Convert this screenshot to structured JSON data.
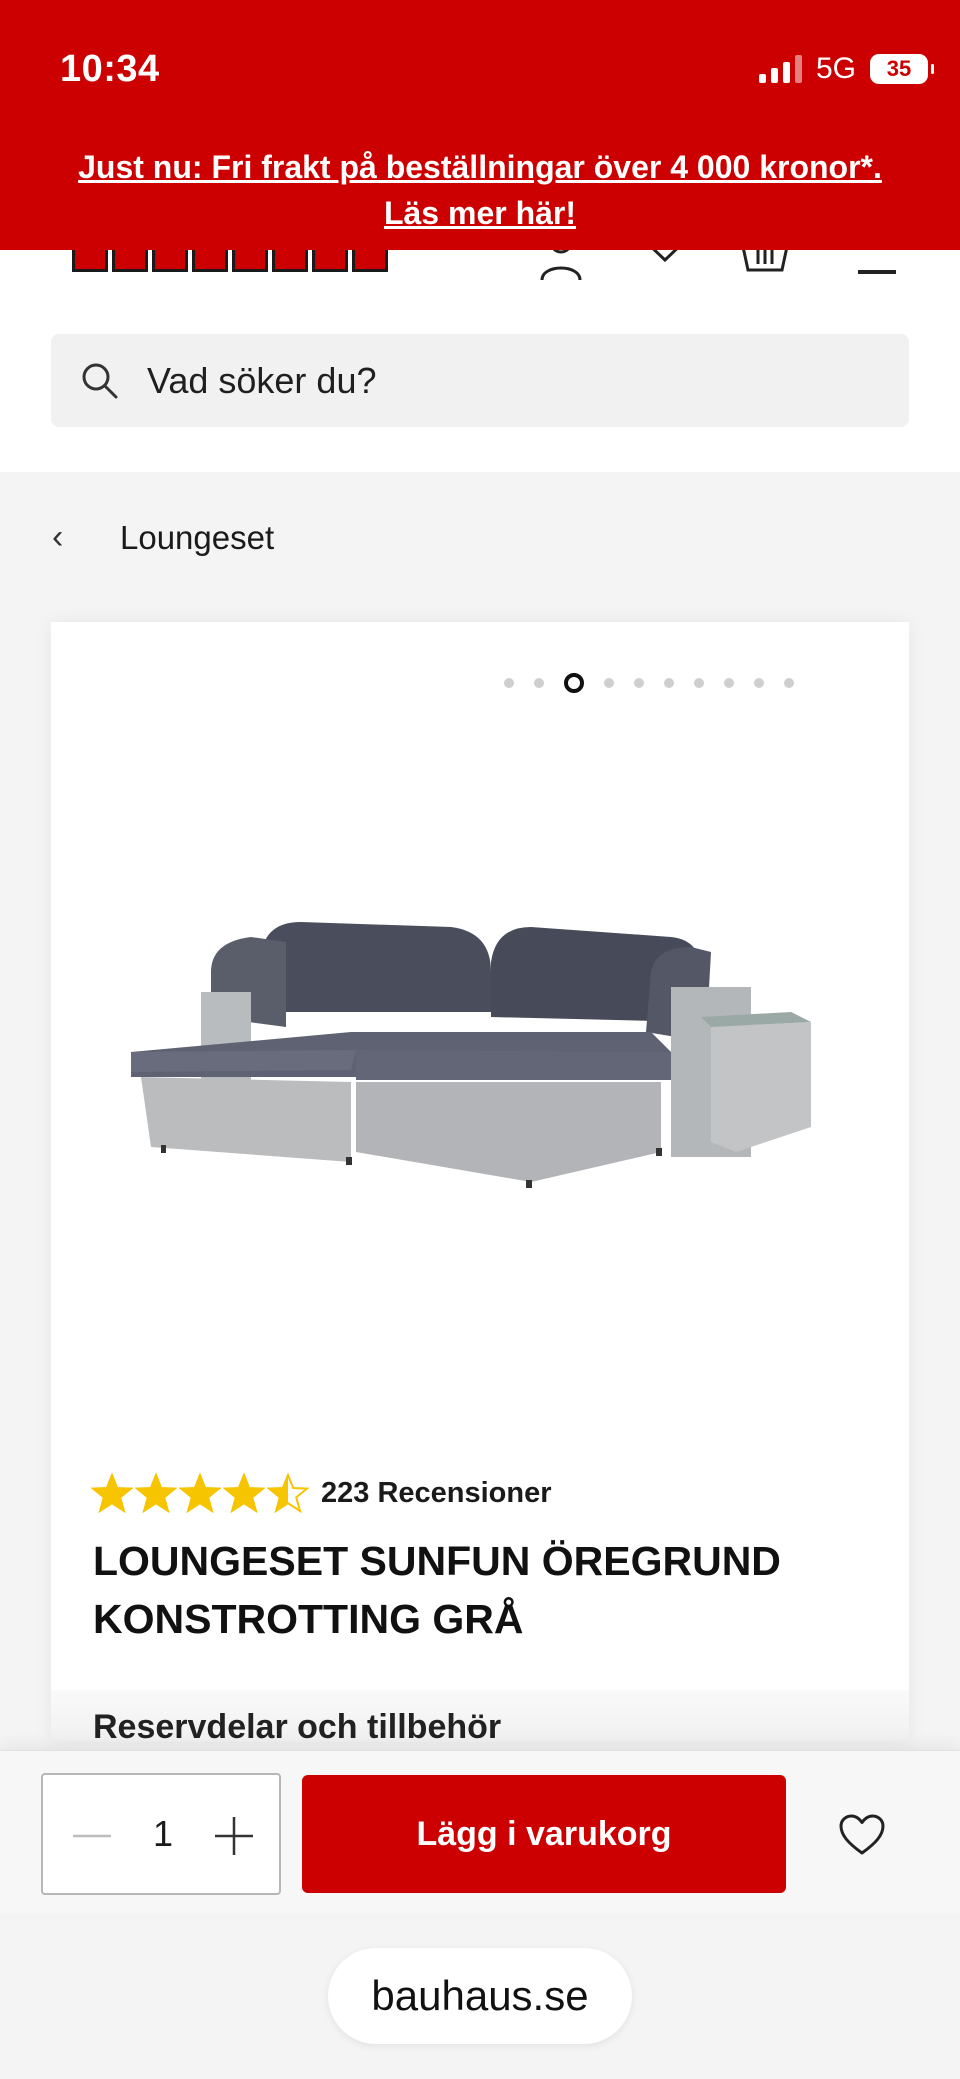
{
  "status_bar": {
    "time": "10:34",
    "network": "5G",
    "battery": "35"
  },
  "promo": {
    "line1": "Just nu: Fri frakt på beställningar över 4 000 kronor*.",
    "line2": "Läs mer här!"
  },
  "header": {
    "logo_alt": "BAUHAUS",
    "icons": [
      "account-icon",
      "heart-icon",
      "basket-icon",
      "menu-icon"
    ]
  },
  "search": {
    "placeholder": "Vad söker du?"
  },
  "breadcrumb": {
    "back_label": "Loungeset"
  },
  "product": {
    "gallery": {
      "total_images": 10,
      "active_index": 2
    },
    "rating": {
      "value": 4.5,
      "max": 5,
      "reviews_label": "223 Recensioner"
    },
    "title": "LOUNGESET SUNFUN ÖREGRUND KONSTROTTING GRÅ",
    "next_section_peek": "Reservdelar och tillbehör"
  },
  "buy_bar": {
    "quantity": "1",
    "add_to_cart_label": "Lägg i varukorg"
  },
  "browser": {
    "url": "bauhaus.se"
  },
  "colors": {
    "brand_red": "#cc0000",
    "star_yellow": "#f7c400"
  }
}
